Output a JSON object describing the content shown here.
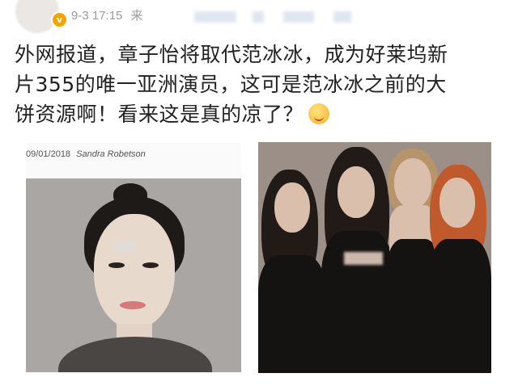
{
  "post": {
    "time": "9-3 17:15",
    "source_prefix": "来",
    "verified_icon": "v-verified-badge-icon",
    "text_line1": "外网报道，章子怡将取代范冰冰，成为好莱坞新",
    "text_line2": "片355的唯一亚洲演员，这可是范冰冰之前的大",
    "text_line3": "饼资源啊！看来这是真的凉了？",
    "emoji": "thinking-emoji-icon"
  },
  "image_left": {
    "date": "09/01/2018",
    "author": "Sandra Robetson"
  },
  "colors": {
    "text": "#222222",
    "meta": "#9a9a9a",
    "verified": "#f5a300"
  }
}
